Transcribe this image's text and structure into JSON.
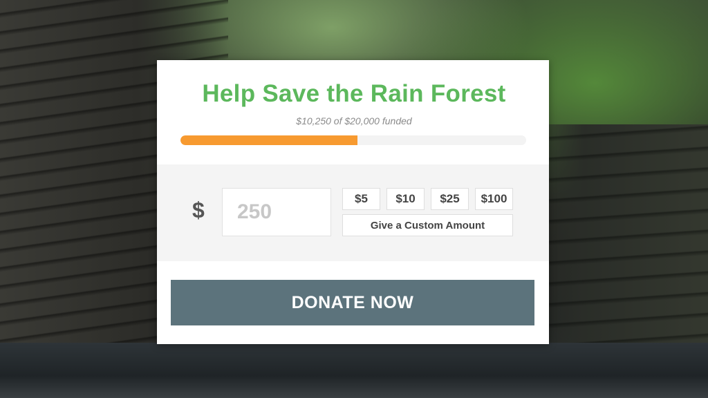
{
  "campaign": {
    "title": "Help Save the Rain Forest",
    "funded_text": "$10,250 of $20,000 funded",
    "progress_fraction": 0.5125
  },
  "donation": {
    "currency_symbol": "$",
    "amount_placeholder": "250",
    "presets": [
      "$5",
      "$10",
      "$25",
      "$100"
    ],
    "custom_label": "Give a Custom Amount"
  },
  "actions": {
    "donate_label": "DONATE NOW"
  },
  "colors": {
    "title": "#5cb85c",
    "progress": "#f79a30",
    "donate_button": "#5c737c"
  }
}
